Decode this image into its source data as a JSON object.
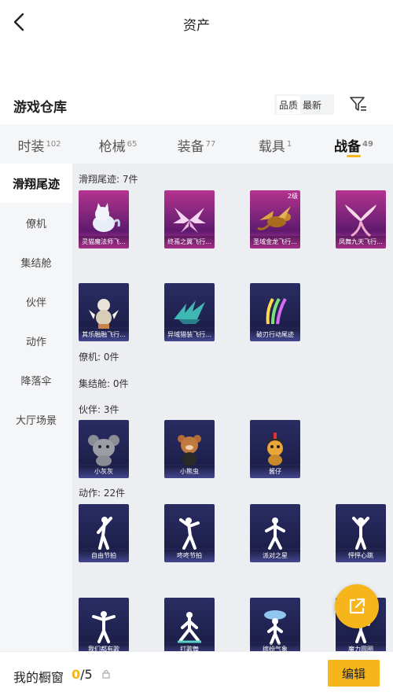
{
  "header": {
    "title": "资产"
  },
  "warehouse": {
    "title": "游戏仓库",
    "sort_options": [
      "品质",
      "最新"
    ],
    "sort_active": "品质"
  },
  "tabs": [
    {
      "label": "时装",
      "count": "102"
    },
    {
      "label": "枪械",
      "count": "65"
    },
    {
      "label": "装备",
      "count": "77"
    },
    {
      "label": "载具",
      "count": "1"
    },
    {
      "label": "战备",
      "count": "49"
    }
  ],
  "active_tab": "战备",
  "sidebar": {
    "items": [
      "滑翔尾迹",
      "僚机",
      "集结舱",
      "伙伴",
      "动作",
      "降落伞",
      "大厅场景"
    ],
    "active": "滑翔尾迹"
  },
  "sections": {
    "trails": {
      "title": "滑翔尾迹: 7件",
      "items": [
        "灵猫魔法师飞...",
        "终焉之翼飞行...",
        "圣域金龙飞行...",
        "凤舞九天飞行...",
        "其乐融融飞行...",
        "异域猎装飞行...",
        "破刃行动尾迹"
      ],
      "badge": "2级"
    },
    "wingman": {
      "title": "僚机: 0件"
    },
    "capsule": {
      "title": "集结舱: 0件"
    },
    "partners": {
      "title": "伙伴: 3件",
      "items": [
        "小灰灰",
        "小熊虫",
        "酱仔"
      ]
    },
    "emotes": {
      "title": "动作: 22件",
      "items": [
        "自由节拍",
        "咚咚节拍",
        "派对之星",
        "怦怦心跳",
        "我们都有歌",
        "打歌舞",
        "缤纷气象",
        "魔力圆圈"
      ]
    }
  },
  "bottom": {
    "label": "我的橱窗",
    "current": "0",
    "total": "/5",
    "edit_label": "编辑"
  },
  "colors": {
    "accent": "#f7b51c"
  }
}
